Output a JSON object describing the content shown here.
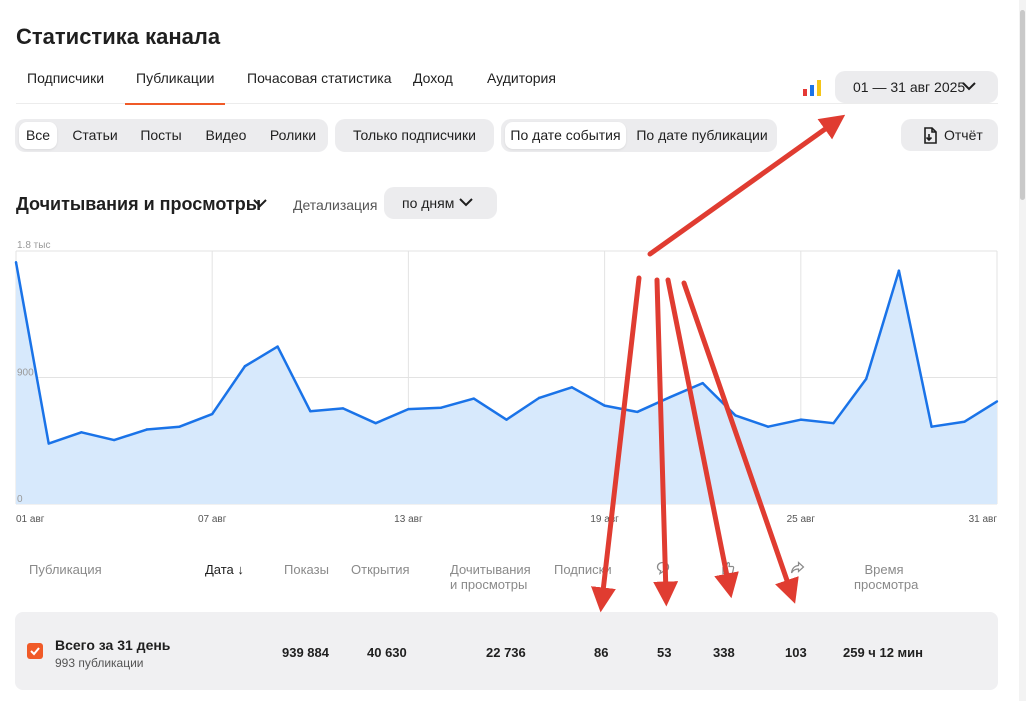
{
  "page": {
    "title": "Статистика канала"
  },
  "tabs": [
    {
      "label": "Подписчики",
      "active": false
    },
    {
      "label": "Публикации",
      "active": true
    },
    {
      "label": "Почасовая статистика",
      "active": false
    },
    {
      "label": "Доход",
      "active": false
    },
    {
      "label": "Аудитория",
      "active": false
    }
  ],
  "date_range": {
    "label": "01 — 31 авг 2025"
  },
  "filters": {
    "types": [
      "Все",
      "Статьи",
      "Посты",
      "Видео",
      "Ролики"
    ],
    "types_active": "Все",
    "subscribers_only": "Только подписчики",
    "date_modes": [
      "По дате события",
      "По дате публикации"
    ],
    "date_mode_active": "По дате события"
  },
  "report": {
    "label": "Отчёт"
  },
  "section": {
    "title": "Дочитывания и просмотры",
    "detail_label": "Детализация",
    "detail_value": "по дням"
  },
  "chart_data": {
    "type": "area",
    "x": [
      "01 авг",
      "02 авг",
      "03 авг",
      "04 авг",
      "05 авг",
      "06 авг",
      "07 авг",
      "08 авг",
      "09 авг",
      "10 авг",
      "11 авг",
      "12 авг",
      "13 авг",
      "14 авг",
      "15 авг",
      "16 авг",
      "17 авг",
      "18 авг",
      "19 авг",
      "20 авг",
      "21 авг",
      "22 авг",
      "23 авг",
      "24 авг",
      "25 авг",
      "26 авг",
      "27 авг",
      "28 авг",
      "29 авг",
      "30 авг",
      "31 авг"
    ],
    "values": [
      1720,
      430,
      510,
      455,
      530,
      550,
      640,
      980,
      1120,
      660,
      680,
      575,
      675,
      685,
      750,
      600,
      755,
      830,
      700,
      655,
      760,
      860,
      630,
      550,
      600,
      575,
      890,
      1660,
      550,
      585,
      730
    ],
    "y_ticks": [
      "0",
      "900",
      "1.8 тыс"
    ],
    "x_ticks": [
      "01 авг",
      "07 авг",
      "13 авг",
      "19 авг",
      "25 авг",
      "31 авг"
    ],
    "ylim": [
      0,
      1800
    ],
    "grid": true,
    "colors": {
      "line": "#1a73e8",
      "fill": "#d7e9fc"
    }
  },
  "table": {
    "columns": {
      "publication": "Публикация",
      "date": "Дата",
      "impressions": "Показы",
      "opens": "Открытия",
      "reads_views_1": "Дочитывания",
      "reads_views_2": "и просмотры",
      "subscriptions": "Подписки",
      "time_1": "Время",
      "time_2": "просмотра"
    },
    "total": {
      "title": "Всего за 31 день",
      "subtitle": "993 публикации",
      "impressions": "939 884",
      "opens": "40 630",
      "reads_views": "22 736",
      "subscriptions": "86",
      "comments": "53",
      "likes": "338",
      "reposts": "103",
      "watch_time": "259 ч 12 мин"
    }
  },
  "colors": {
    "accent": "#f05a28",
    "annotation": "#e03c31",
    "chip_bg": "#ececee"
  }
}
